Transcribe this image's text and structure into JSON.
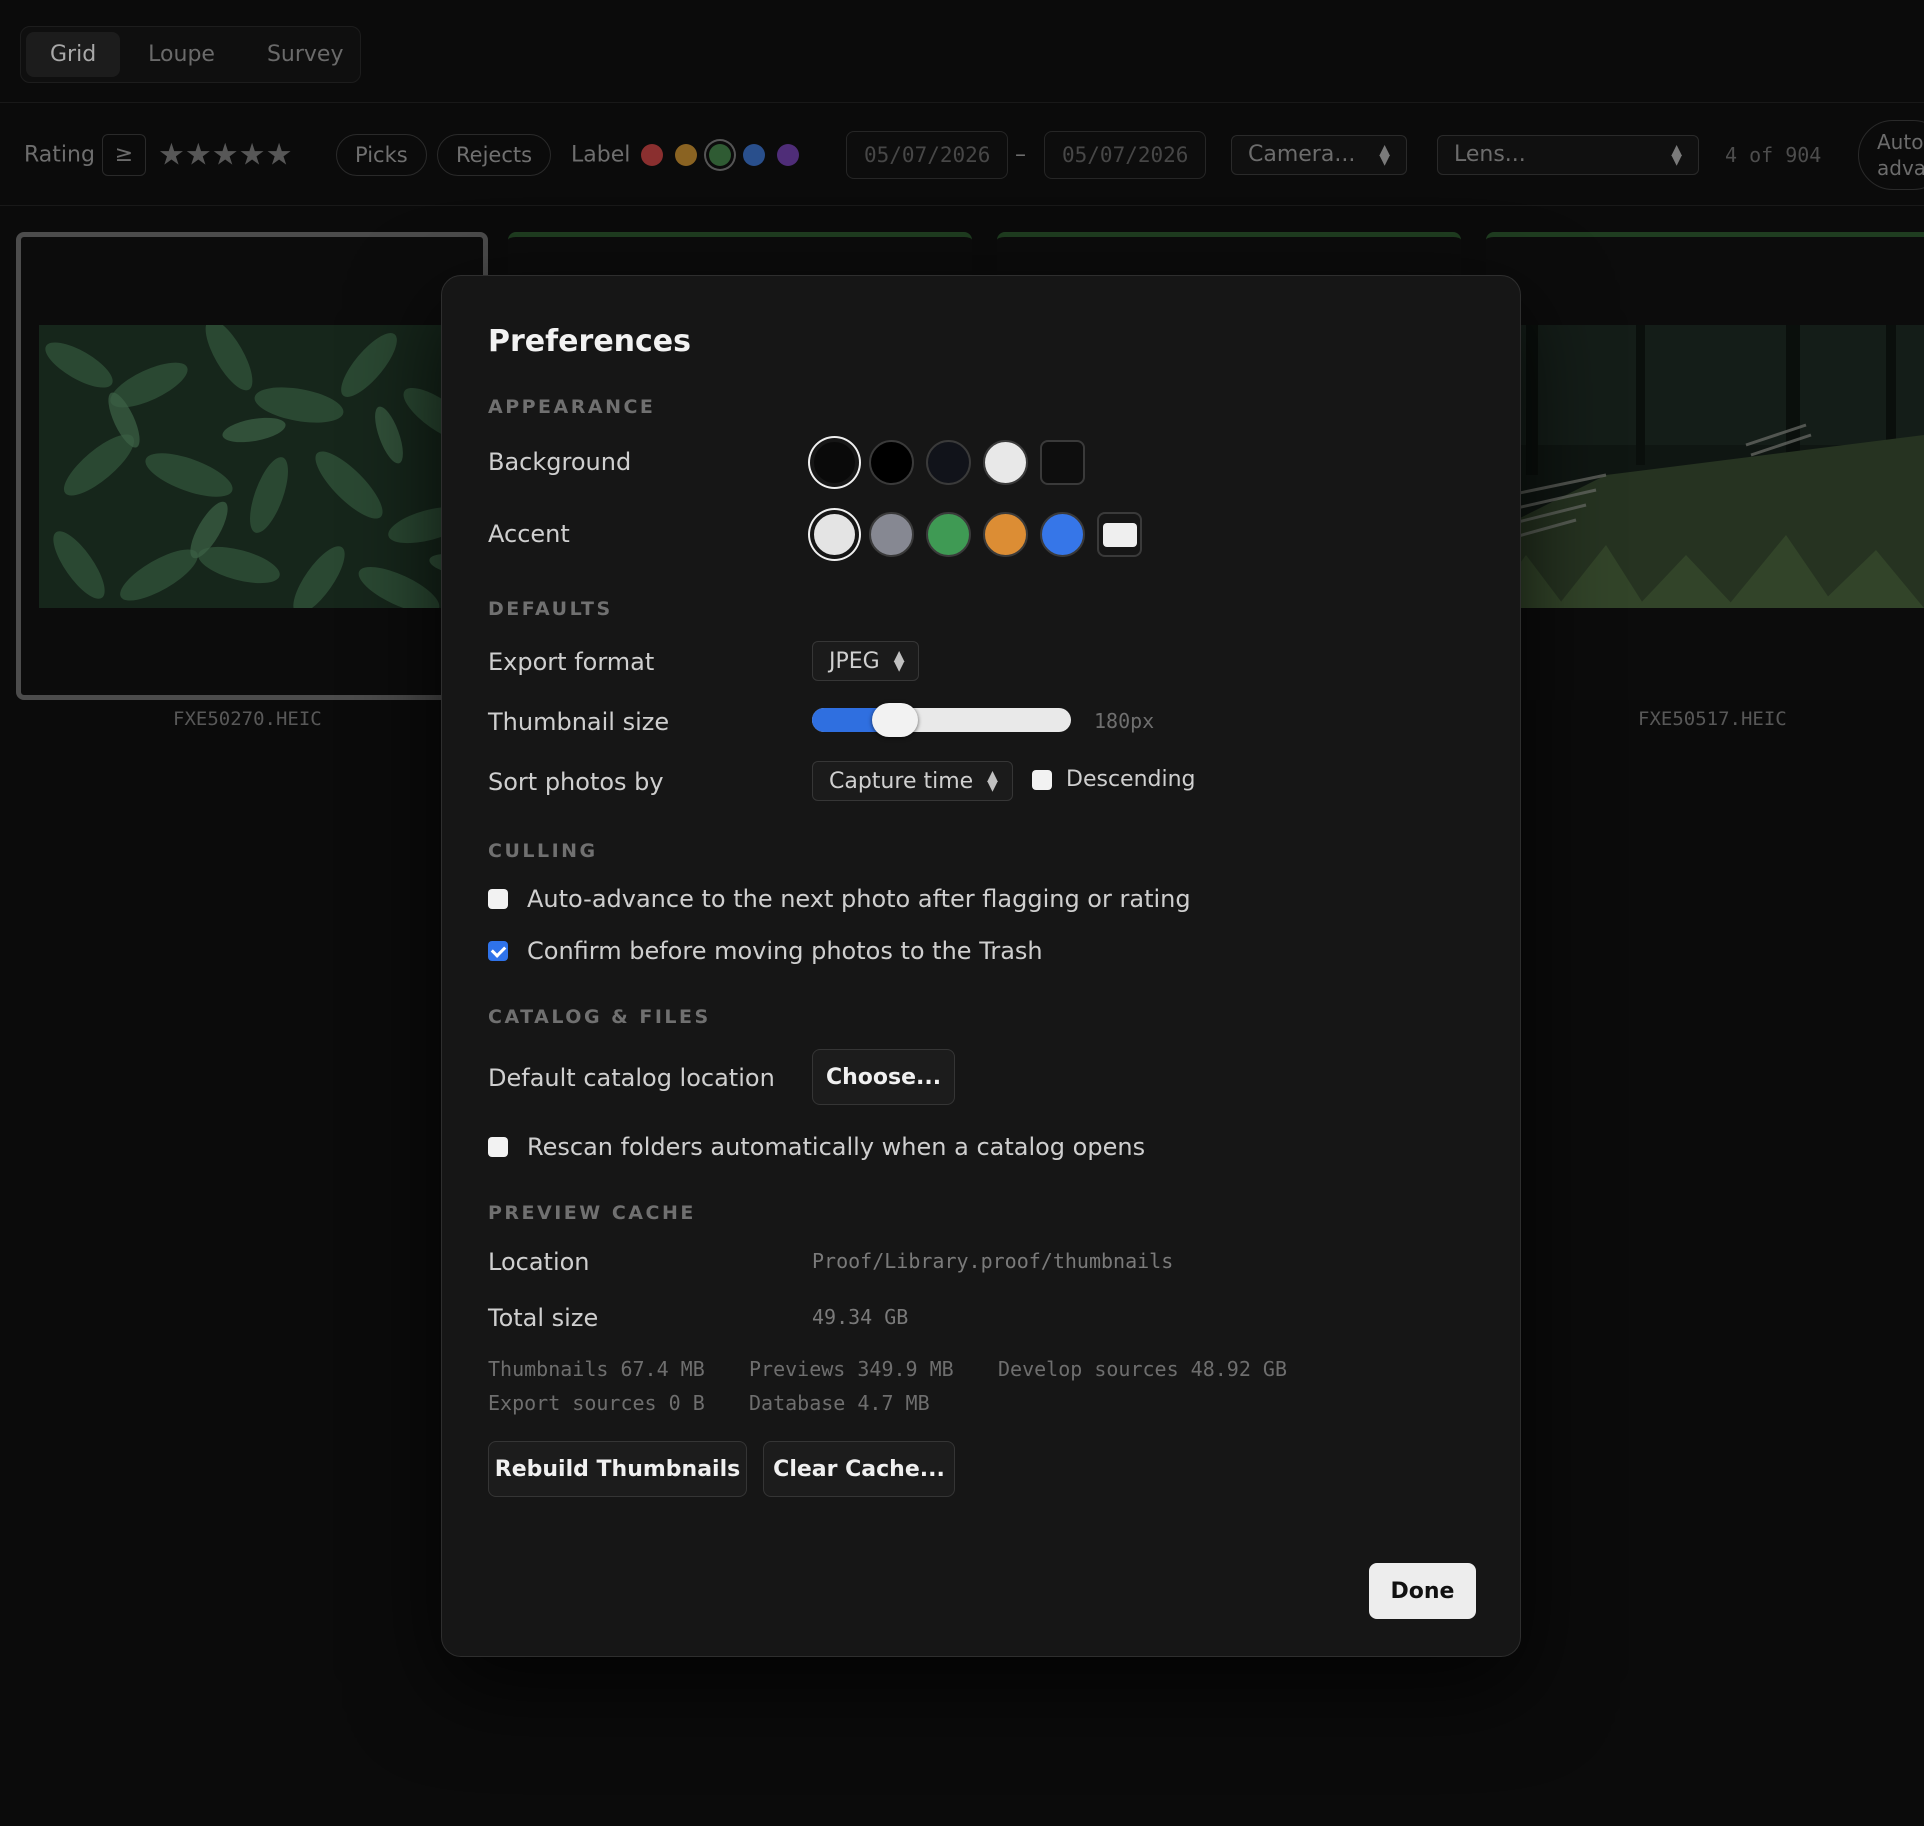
{
  "view_tabs": [
    "Grid",
    "Loupe",
    "Survey"
  ],
  "filter": {
    "rating_label": "Rating",
    "rating_op": "≥",
    "stars": "★★★★★",
    "picks": "Picks",
    "rejects": "Rejects",
    "label_label": "Label",
    "label_colors": [
      "#8a2f2f",
      "#8a6322",
      "#2f5b33",
      "#294f8c",
      "#4f2d78"
    ],
    "date_from": "05/07/2026",
    "date_sep": "–",
    "date_to": "05/07/2026",
    "camera": "Camera...",
    "lens": "Lens...",
    "count": "4 of 904",
    "auto_advance": "Auto-advance"
  },
  "thumbnails": [
    {
      "name": "FXE50270.HEIC"
    },
    {
      "name": ""
    },
    {
      "name": ""
    },
    {
      "name": "FXE50517.HEIC"
    }
  ],
  "dialog": {
    "title": "Preferences",
    "appearance": {
      "heading": "APPEARANCE",
      "background_label": "Background",
      "background_colors": [
        "#0a0a0a",
        "#000000",
        "#11131a",
        "#e8e8e8",
        "#0e0e0e"
      ],
      "accent_label": "Accent",
      "accent_colors": [
        "#e4e4e4",
        "#868892",
        "#3f9a54",
        "#dc8d34",
        "#3676e8",
        "#efefef"
      ]
    },
    "defaults": {
      "heading": "DEFAULTS",
      "export_label": "Export format",
      "export_value": "JPEG",
      "thumb_label": "Thumbnail size",
      "thumb_value": "180px",
      "thumb_fraction": 0.32,
      "sort_label": "Sort photos by",
      "sort_value": "Capture time",
      "descending_label": "Descending",
      "descending_checked": false
    },
    "culling": {
      "heading": "CULLING",
      "auto_advance_label": "Auto-advance to the next photo after flagging or rating",
      "auto_advance_checked": false,
      "confirm_trash_label": "Confirm before moving photos to the Trash",
      "confirm_trash_checked": true
    },
    "catalog": {
      "heading": "CATALOG & FILES",
      "location_label": "Default catalog location",
      "choose_button": "Choose...",
      "rescan_label": "Rescan folders automatically when a catalog opens",
      "rescan_checked": false
    },
    "cache": {
      "heading": "PREVIEW CACHE",
      "location_label": "Location",
      "location_value": "Proof/Library.proof/thumbnails",
      "total_label": "Total size",
      "total_value": "49.34 GB",
      "thumbnails": "Thumbnails 67.4 MB",
      "previews": "Previews 349.9 MB",
      "develop_sources": "Develop sources 48.92 GB",
      "export_sources": "Export sources 0 B",
      "database": "Database 4.7 MB",
      "rebuild_button": "Rebuild Thumbnails",
      "clear_button": "Clear Cache..."
    },
    "done_button": "Done"
  }
}
